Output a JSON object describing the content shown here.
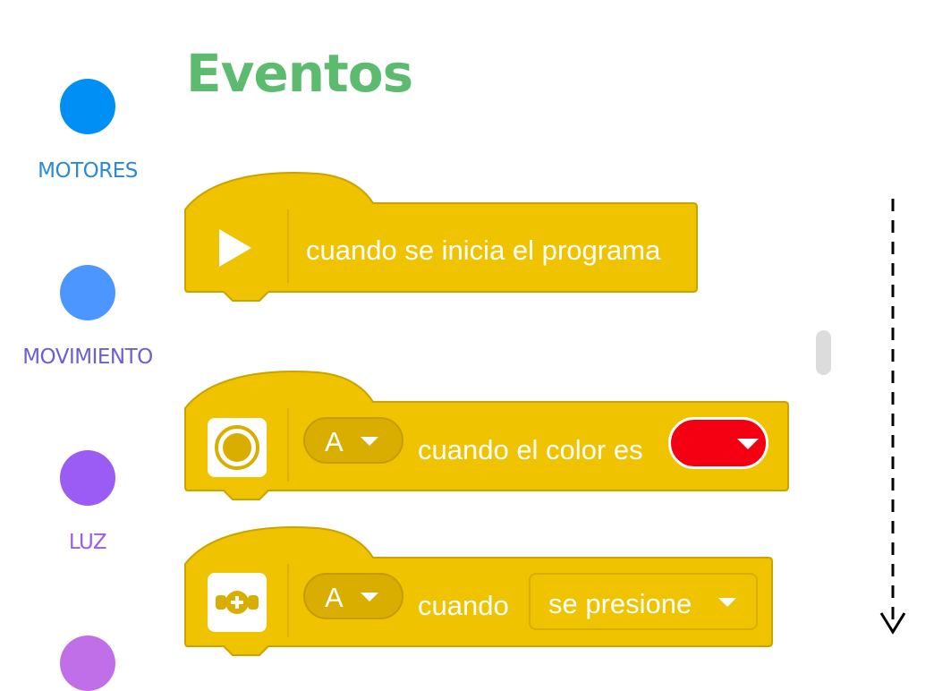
{
  "palette": {
    "categories": [
      {
        "label": "MOTORES",
        "color": "#0090f5",
        "label_color": "#2a8ad8"
      },
      {
        "label": "MOVIMIENTO",
        "color": "#4c97ff",
        "label_color": "#6b5fd6"
      },
      {
        "label": "LUZ",
        "color": "#9a5cf5",
        "label_color": "#9a5cf5"
      },
      {
        "label": "",
        "color": "#c06fe8",
        "label_color": "#c06fe8"
      }
    ]
  },
  "section": {
    "title": "Eventos",
    "color": "#5cbb6e"
  },
  "blocks": {
    "start": {
      "icon": "play-icon",
      "text": "cuando se inicia el programa"
    },
    "color": {
      "icon": "color-sensor-icon",
      "port": "A",
      "text": "cuando el color es",
      "color_value": "#f40012"
    },
    "force": {
      "icon": "force-sensor-icon",
      "port": "A",
      "text": "cuando",
      "state": "se presione"
    }
  },
  "theme": {
    "block_fill": "#f0c300",
    "block_stroke": "#c9a300"
  }
}
